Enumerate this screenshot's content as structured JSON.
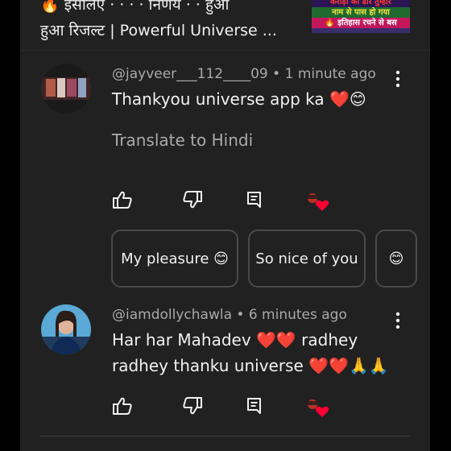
{
  "video": {
    "title_line1": "🔥 इसलिए · · · · निर्णय · · हुआ",
    "title_line2": "हुआ रिजल्ट | Powerful Universe ...",
    "thumbnail_lines": [
      "करोड़ो की डोर तुम्हारे",
      "नाम से पास हो गया",
      "🔥 इतिहास रचने से बस"
    ]
  },
  "comments": [
    {
      "author": "@jayveer___112____09",
      "time": "1 minute ago",
      "text": "Thankyou universe app ka ❤️😊",
      "translate_label": "Translate to Hindi",
      "suggestions": [
        "My pleasure 😊",
        "So nice of you",
        "😊"
      ]
    },
    {
      "author": "@iamdollychawla",
      "time": "6 minutes ago",
      "text_line1": "Har har Mahadev ❤️❤️ radhey",
      "text_line2": "radhey thanku universe ❤️❤️🙏🙏"
    }
  ],
  "separator": " • ",
  "icons": [
    "like-icon",
    "dislike-icon",
    "reply-icon",
    "creator-heart-icon",
    "more-vert-icon"
  ],
  "colors": {
    "background": "#212121",
    "text": "#f1f1f1",
    "secondary": "#aaaaaa",
    "heart": "#ff0033"
  }
}
